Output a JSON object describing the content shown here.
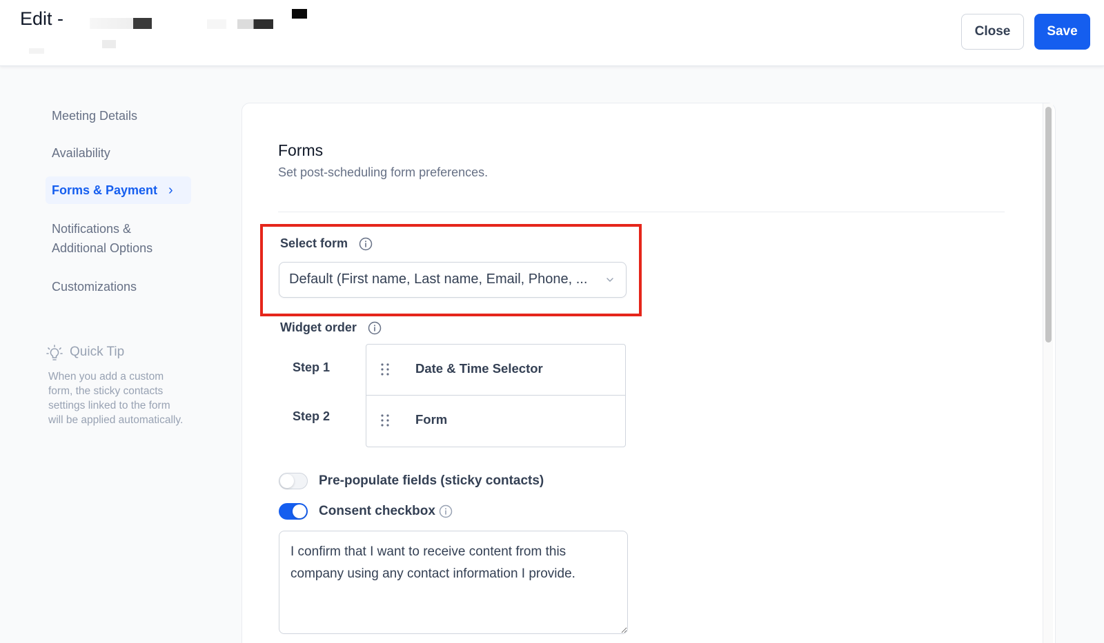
{
  "header": {
    "title": "Edit -",
    "close_label": "Close",
    "save_label": "Save",
    "colors": {
      "primary": "#155eef",
      "highlight": "#e5261b"
    }
  },
  "sidebar": {
    "items": [
      {
        "label": "Meeting Details",
        "active": false
      },
      {
        "label": "Availability",
        "active": false
      },
      {
        "label": "Forms & Payment",
        "active": true
      },
      {
        "label_line1": "Notifications &",
        "label_line2": "Additional Options",
        "active": false
      },
      {
        "label": "Customizations",
        "active": false
      }
    ],
    "quick_tip": {
      "title": "Quick Tip",
      "icon": "lightbulb-icon",
      "text": "When you add a custom form, the sticky contacts settings linked to the form will be applied automatically."
    }
  },
  "forms": {
    "title": "Forms",
    "subtitle": "Set post-scheduling form preferences.",
    "select_form": {
      "label": "Select form",
      "value": "Default (First name, Last name, Email, Phone, ..."
    },
    "widget_order": {
      "label": "Widget order",
      "steps": [
        {
          "step": "Step 1",
          "widget": "Date & Time Selector"
        },
        {
          "step": "Step 2",
          "widget": "Form"
        }
      ]
    },
    "prepopulate": {
      "label": "Pre-populate fields (sticky contacts)",
      "enabled": false
    },
    "consent": {
      "label": "Consent checkbox",
      "enabled": true,
      "text": "I confirm that I want to receive content from this company using any contact information I provide."
    }
  }
}
